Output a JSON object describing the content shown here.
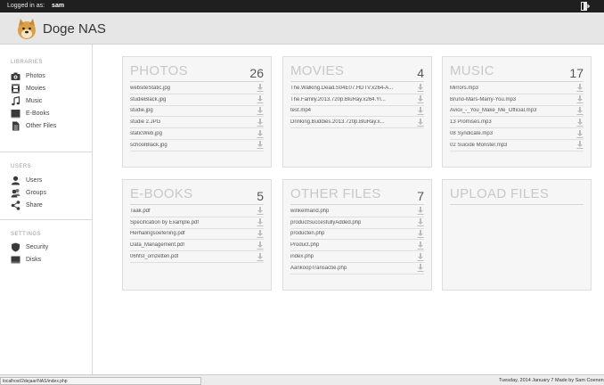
{
  "topbar": {
    "logged_label": "Logged in as:",
    "username": "sam"
  },
  "header": {
    "title": "Doge NAS"
  },
  "sidebar": {
    "sections": [
      {
        "title": "LIBRARIES",
        "items": [
          {
            "label": "Photos",
            "icon": "camera-icon"
          },
          {
            "label": "Movies",
            "icon": "film-icon"
          },
          {
            "label": "Music",
            "icon": "music-note-icon"
          },
          {
            "label": "E-Books",
            "icon": "book-icon"
          },
          {
            "label": "Other Files",
            "icon": "document-icon"
          }
        ]
      },
      {
        "title": "USERS",
        "items": [
          {
            "label": "Users",
            "icon": "user-icon"
          },
          {
            "label": "Groups",
            "icon": "group-icon"
          },
          {
            "label": "Share",
            "icon": "share-icon"
          }
        ]
      },
      {
        "title": "SETTINGS",
        "items": [
          {
            "label": "Security",
            "icon": "shield-icon"
          },
          {
            "label": "Disks",
            "icon": "disk-icon"
          }
        ]
      }
    ]
  },
  "panels": {
    "photos": {
      "title": "PHOTOS",
      "count": "26",
      "files": [
        "websiteStatic.jpg",
        "studieBlack.jpg",
        "studie.jpg",
        "studie 2.JPG",
        "staticWeb.jpg",
        "schoolBlack.jpg"
      ]
    },
    "movies": {
      "title": "MOVIES",
      "count": "4",
      "files": [
        "The.Walking.Dead.S04E07.HDTV.x264-A...",
        "The.Family.2013.720p.BluRay.x264.YI...",
        "test.mp4",
        "Drinking.Buddies.2013.720p.BluRay.x..."
      ]
    },
    "music": {
      "title": "MUSIC",
      "count": "17",
      "files": [
        "Mirrors.mp3",
        "Bruno-Mars-Marry-You.mp3",
        "Avicii_-_You_Make_Me_Official.mp3",
        "13 Promises.mp3",
        "08 Syndicate.mp3",
        "02 Suicide Monster.mp3"
      ]
    },
    "ebooks": {
      "title": "E-BOOKS",
      "count": "5",
      "files": [
        "Taak.pdf",
        "Specification by Example.pdf",
        "Herhalingsoefening.pdf",
        "Data_Management.pdf",
        "06hfst_omzetten.pdf"
      ]
    },
    "other": {
      "title": "OTHER FILES",
      "count": "7",
      "files": [
        "winkelmand.php",
        "productSuccesfullyAdded.php",
        "producten.php",
        "Product.php",
        "index.php",
        "AankoopTransactie.php"
      ]
    },
    "upload": {
      "title": "UPLOAD FILES"
    }
  },
  "status": {
    "url": "localhost/2dejaar/NAS/index.php",
    "date": "Tuesday, 2014 January 7",
    "made_by": "Made by Sam Coenen"
  },
  "colors": {
    "topbar": "#1f1f1f",
    "header": "#e6e6e6",
    "panel": "#f6f6f6"
  }
}
